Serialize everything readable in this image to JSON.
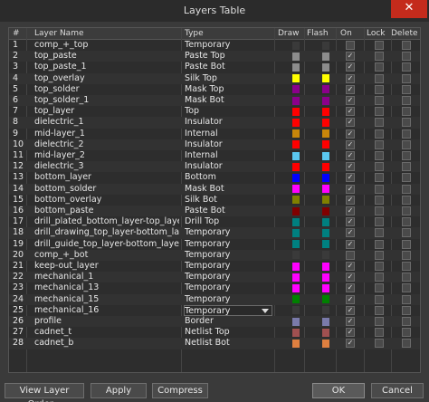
{
  "window": {
    "title": "Layers Table",
    "close_label": "✕"
  },
  "columns": [
    "#",
    "Layer Name",
    "Type",
    "Draw",
    "Flash",
    "On",
    "Lock",
    "Delete"
  ],
  "rows": [
    {
      "num": "1",
      "name": "comp_+_top",
      "type": "Temporary",
      "draw": "#3a3a3a",
      "flash": "#3a3a3a",
      "on": false
    },
    {
      "num": "2",
      "name": "top_paste",
      "type": "Paste Top",
      "draw": "#8c8c8c",
      "flash": "#8c8c8c",
      "on": true
    },
    {
      "num": "3",
      "name": "top_paste_1",
      "type": "Paste Bot",
      "draw": "#8c8c8c",
      "flash": "#8c8c8c",
      "on": true
    },
    {
      "num": "4",
      "name": "top_overlay",
      "type": "Silk Top",
      "draw": "#ffff00",
      "flash": "#ffff00",
      "on": true
    },
    {
      "num": "5",
      "name": "top_solder",
      "type": "Mask Top",
      "draw": "#8b008b",
      "flash": "#8b008b",
      "on": true
    },
    {
      "num": "6",
      "name": "top_solder_1",
      "type": "Mask Bot",
      "draw": "#8b008b",
      "flash": "#8b008b",
      "on": true
    },
    {
      "num": "7",
      "name": "top_layer",
      "type": "Top",
      "draw": "#ff0000",
      "flash": "#ff0000",
      "on": true
    },
    {
      "num": "8",
      "name": "dielectric_1",
      "type": "Insulator",
      "draw": "#ff0000",
      "flash": "#ff0000",
      "on": true
    },
    {
      "num": "9",
      "name": "mid-layer_1",
      "type": "Internal",
      "draw": "#c8860a",
      "flash": "#c8860a",
      "on": true
    },
    {
      "num": "10",
      "name": "dielectric_2",
      "type": "Insulator",
      "draw": "#ff0000",
      "flash": "#ff0000",
      "on": true
    },
    {
      "num": "11",
      "name": "mid-layer_2",
      "type": "Internal",
      "draw": "#5bc8f0",
      "flash": "#5bc8f0",
      "on": true
    },
    {
      "num": "12",
      "name": "dielectric_3",
      "type": "Insulator",
      "draw": "#ff0000",
      "flash": "#ff0000",
      "on": true
    },
    {
      "num": "13",
      "name": "bottom_layer",
      "type": "Bottom",
      "draw": "#0000ff",
      "flash": "#0000ff",
      "on": true
    },
    {
      "num": "14",
      "name": "bottom_solder",
      "type": "Mask Bot",
      "draw": "#ff00ff",
      "flash": "#ff00ff",
      "on": true
    },
    {
      "num": "15",
      "name": "bottom_overlay",
      "type": "Silk Bot",
      "draw": "#808000",
      "flash": "#808000",
      "on": true
    },
    {
      "num": "16",
      "name": "bottom_paste",
      "type": "Paste Bot",
      "draw": "#800000",
      "flash": "#800000",
      "on": true
    },
    {
      "num": "17",
      "name": "drill_plated_bottom_layer-top_layer",
      "type": "Drill Top",
      "draw": "#008080",
      "flash": "#008080",
      "on": true
    },
    {
      "num": "18",
      "name": "drill_drawing_top_layer-bottom_layer",
      "type": "Temporary",
      "draw": "#008080",
      "flash": "#008080",
      "on": true
    },
    {
      "num": "19",
      "name": "drill_guide_top_layer-bottom_layer",
      "type": "Temporary",
      "draw": "#008080",
      "flash": "#008080",
      "on": true
    },
    {
      "num": "20",
      "name": "comp_+_bot",
      "type": "Temporary",
      "draw": "#3a3a3a",
      "flash": "#3a3a3a",
      "on": false
    },
    {
      "num": "21",
      "name": "keep-out_layer",
      "type": "Temporary",
      "draw": "#ff00ff",
      "flash": "#ff00ff",
      "on": true
    },
    {
      "num": "22",
      "name": "mechanical_1",
      "type": "Temporary",
      "draw": "#ff00ff",
      "flash": "#ff00ff",
      "on": true
    },
    {
      "num": "23",
      "name": "mechanical_13",
      "type": "Temporary",
      "draw": "#ff00ff",
      "flash": "#ff00ff",
      "on": true
    },
    {
      "num": "24",
      "name": "mechanical_15",
      "type": "Temporary",
      "draw": "#008000",
      "flash": "#008000",
      "on": true
    },
    {
      "num": "25",
      "name": "mechanical_16",
      "type": "Temporary",
      "draw": "#3a3a3a",
      "flash": "#3a3a3a",
      "on": true,
      "editing": true
    },
    {
      "num": "26",
      "name": "profile",
      "type": "Border",
      "draw": "#7a7aaa",
      "flash": "#7a7aaa",
      "on": true
    },
    {
      "num": "27",
      "name": "cadnet_t",
      "type": "Netlist Top",
      "draw": "#a05050",
      "flash": "#a05050",
      "on": true
    },
    {
      "num": "28",
      "name": "cadnet_b",
      "type": "Netlist Bot",
      "draw": "#e08040",
      "flash": "#e08040",
      "on": true
    }
  ],
  "buttons": {
    "view_layer_order": "View Layer Order...",
    "apply": "Apply",
    "compress": "Compress",
    "ok": "OK",
    "cancel": "Cancel"
  }
}
